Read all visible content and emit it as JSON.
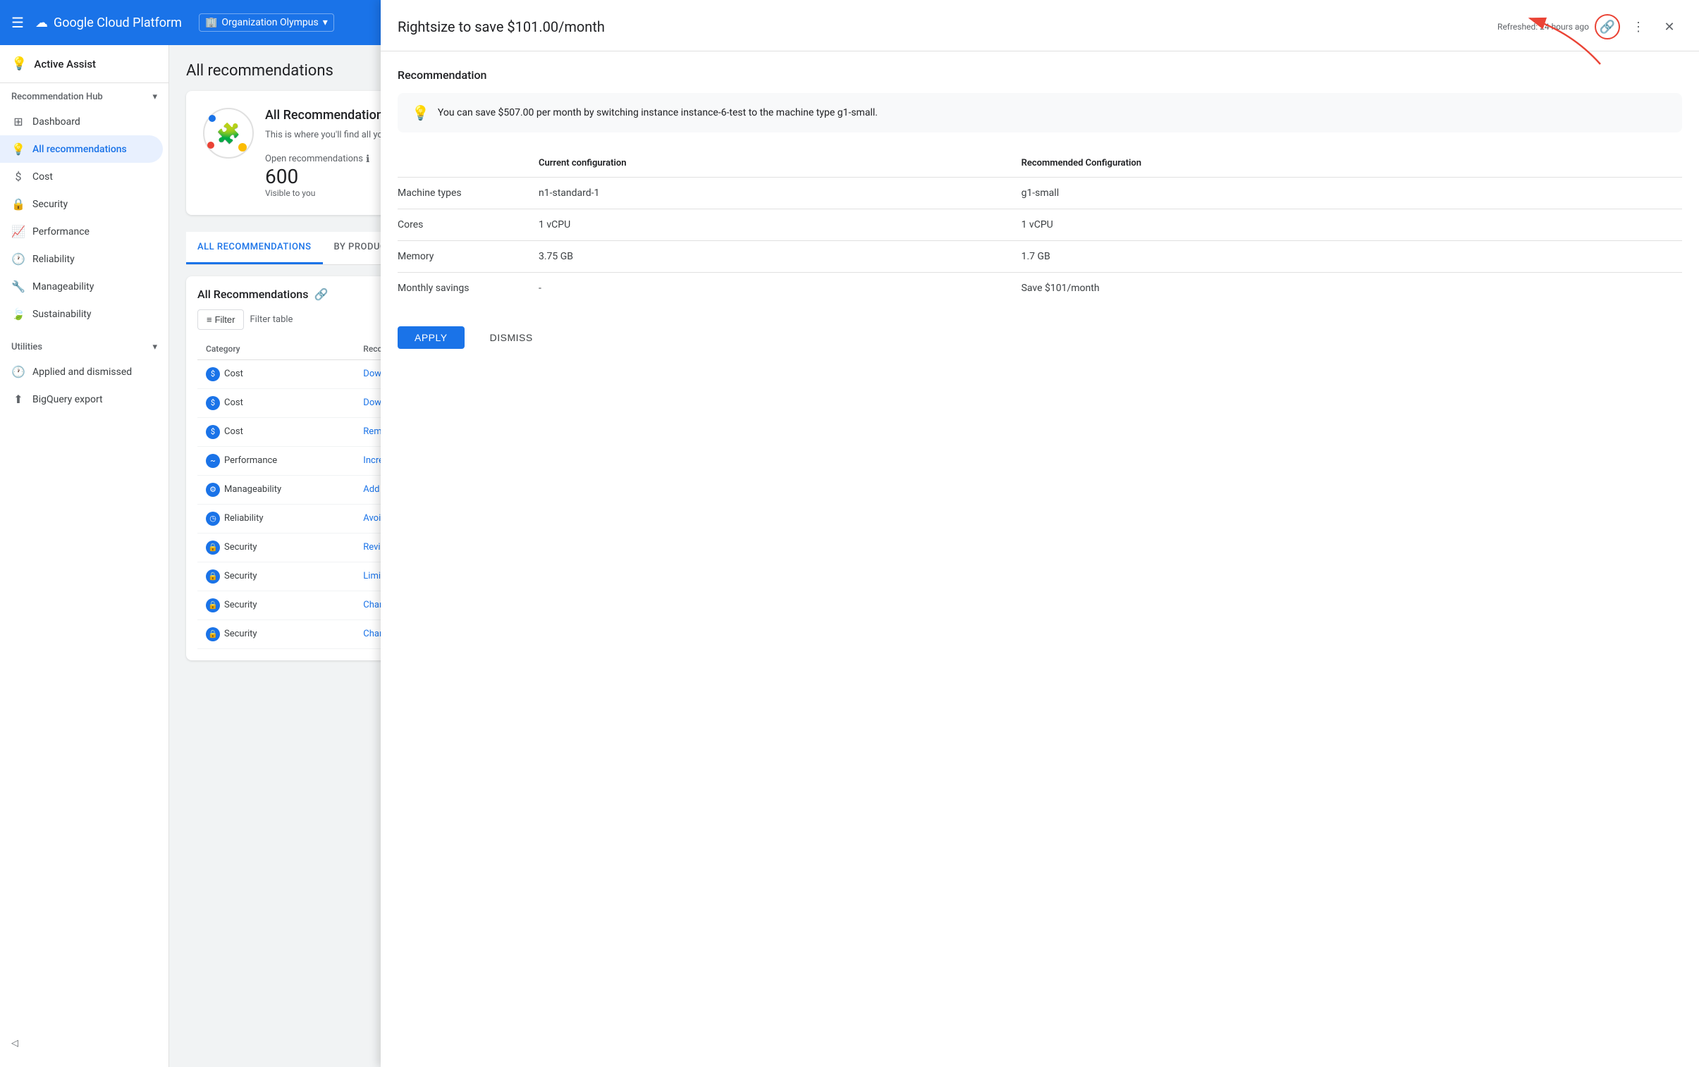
{
  "header": {
    "menu_label": "☰",
    "title": "Google Cloud Platform",
    "org_icon": "🏢",
    "org_name": "Organization Olympus",
    "org_arrow": "▾"
  },
  "sidebar": {
    "active_assist_label": "Active Assist",
    "active_assist_icon": "💡",
    "recommendation_hub": {
      "label": "Recommendation Hub",
      "chevron": "▾",
      "items": [
        {
          "id": "dashboard",
          "label": "Dashboard",
          "icon": "⊞"
        },
        {
          "id": "all-recommendations",
          "label": "All recommendations",
          "icon": "💡",
          "active": true
        },
        {
          "id": "cost",
          "label": "Cost",
          "icon": "$"
        },
        {
          "id": "security",
          "label": "Security",
          "icon": "🔒"
        },
        {
          "id": "performance",
          "label": "Performance",
          "icon": "📈"
        },
        {
          "id": "reliability",
          "label": "Reliability",
          "icon": "🕐"
        },
        {
          "id": "manageability",
          "label": "Manageability",
          "icon": "🔧"
        },
        {
          "id": "sustainability",
          "label": "Sustainability",
          "icon": "🍃"
        }
      ]
    },
    "utilities": {
      "label": "Utilities",
      "chevron": "▾",
      "items": [
        {
          "id": "applied-dismissed",
          "label": "Applied and dismissed",
          "icon": "🕐"
        },
        {
          "id": "bigquery-export",
          "label": "BigQuery export",
          "icon": "⬆"
        }
      ]
    },
    "collapse_label": "◁"
  },
  "main": {
    "page_title": "All recommendations",
    "overview_card": {
      "title": "All Recommendations",
      "desc": "This is where you'll find all your re... don't have the correct IAM permis...",
      "open_recs_label": "Open recommendations",
      "open_recs_count": "600",
      "visible_label": "Visible to you"
    },
    "tabs": [
      {
        "id": "all",
        "label": "ALL RECOMMENDATIONS",
        "active": true
      },
      {
        "id": "by-product",
        "label": "BY PRODUCT"
      }
    ],
    "all_recs_section": {
      "title": "All Recommendations",
      "filter_btn_label": "Filter",
      "filter_table_label": "Filter table",
      "columns": [
        "Category",
        "Recommendation"
      ],
      "rows": [
        {
          "category": "Cost",
          "category_type": "cost",
          "recommendation": "Downsize a VM"
        },
        {
          "category": "Cost",
          "category_type": "cost",
          "recommendation": "Downsize Cloud SQL ins..."
        },
        {
          "category": "Cost",
          "category_type": "cost",
          "recommendation": "Remove an idle disk"
        },
        {
          "category": "Performance",
          "category_type": "performance",
          "recommendation": "Increase VM performan..."
        },
        {
          "category": "Manageability",
          "category_type": "manageability",
          "recommendation": "Add fleet-wide monitori..."
        },
        {
          "category": "Reliability",
          "category_type": "reliability",
          "recommendation": "Avoid out-of-disk issue..."
        },
        {
          "category": "Security",
          "category_type": "security",
          "recommendation": "Review overly permissiv..."
        },
        {
          "category": "Security",
          "category_type": "security",
          "recommendation": "Limit cross-project impe..."
        },
        {
          "category": "Security",
          "category_type": "security",
          "recommendation": "Change IAM role grants..."
        },
        {
          "category": "Security",
          "category_type": "security",
          "recommendation": "Change IAM role grants..."
        }
      ]
    }
  },
  "panel": {
    "title": "Rightsize to save $101.00/month",
    "refreshed_label": "Refreshed: 24 hours ago",
    "recommendation_section_title": "Recommendation",
    "info_text": "You can save $507.00 per month by switching instance instance-6-test to the machine type g1-small.",
    "config_table": {
      "headers": [
        "",
        "Current configuration",
        "Recommended Configuration"
      ],
      "rows": [
        {
          "label": "Machine types",
          "current": "n1-standard-1",
          "recommended": "g1-small"
        },
        {
          "label": "Cores",
          "current": "1 vCPU",
          "recommended": "1 vCPU"
        },
        {
          "label": "Memory",
          "current": "3.75 GB",
          "recommended": "1.7 GB"
        },
        {
          "label": "Monthly savings",
          "current": "-",
          "recommended": "Save $101/month"
        }
      ]
    },
    "apply_btn": "APPLY",
    "dismiss_btn": "DISMISS"
  },
  "icons": {
    "menu": "☰",
    "link": "🔗",
    "more_vert": "⋮",
    "close": "✕",
    "info": "ℹ",
    "lightbulb": "💡",
    "filter": "≡"
  }
}
